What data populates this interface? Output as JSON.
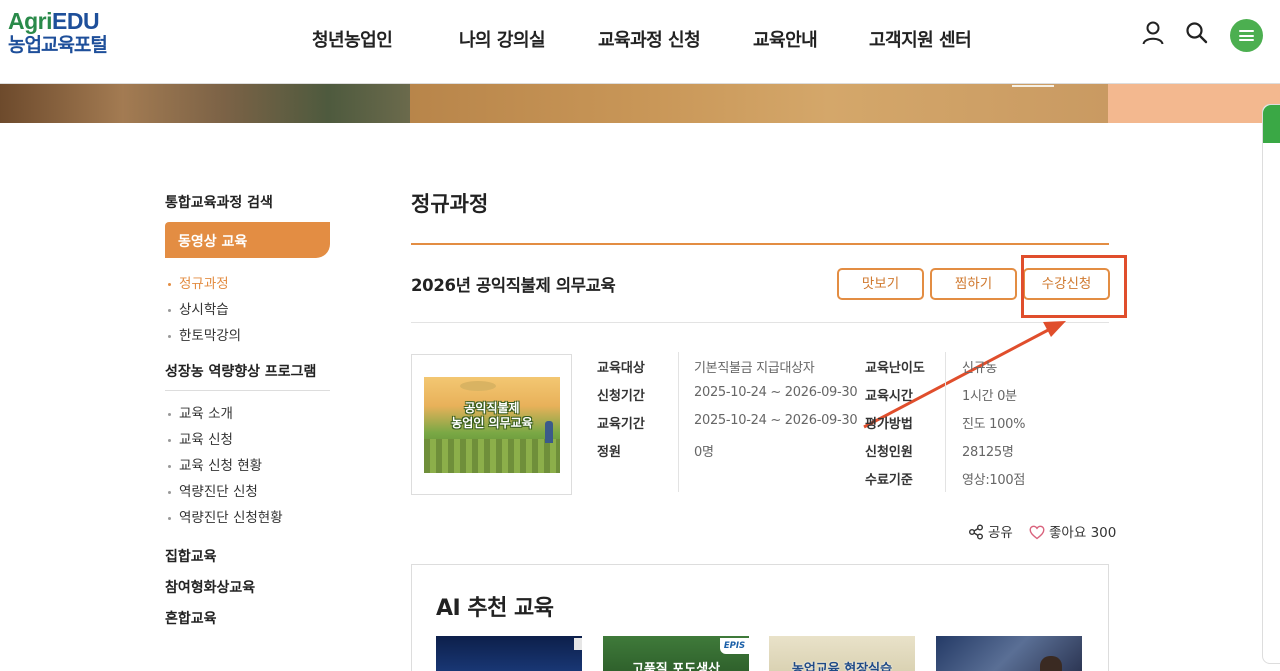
{
  "logo": {
    "line1_agri": "Agri",
    "line1_edu": "EDU",
    "line2": "농업교육포털"
  },
  "gnb": [
    "청년농업인",
    "나의 강의실",
    "교육과정 신청",
    "교육안내",
    "고객지원 센터"
  ],
  "icons": {
    "user": "user-icon",
    "search": "search-icon",
    "menu": "hamburger-menu-icon"
  },
  "colors": {
    "accent": "#e38d43",
    "brand_blue": "#1e4f9a",
    "brand_green": "#4caf50",
    "highlight_red": "#e04e2c"
  },
  "sidebar": {
    "title": "통합교육과정 검색",
    "active": "동영상 교육",
    "video_items": [
      {
        "label": "정규과정",
        "active": true
      },
      {
        "label": "상시학습",
        "active": false
      },
      {
        "label": "한토막강의",
        "active": false
      }
    ],
    "program_title": "성장농 역량향상 프로그램",
    "program_items": [
      "교육 소개",
      "교육 신청",
      "교육 신청 현황",
      "역량진단 신청",
      "역량진단 신청현황"
    ],
    "groups": [
      "집합교육",
      "참여형화상교육",
      "혼합교육"
    ]
  },
  "main": {
    "page_title": "정규과정",
    "course_title": "2026년 공익직불제 의무교육",
    "buttons": {
      "preview": "맛보기",
      "bookmark": "찜하기",
      "apply": "수강신청"
    },
    "thumb_text_1": "공익직불제",
    "thumb_text_2": "농업인 의무교육",
    "info_left": [
      {
        "label": "교육대상",
        "value": "기본직불금 지급대상자"
      },
      {
        "label": "신청기간",
        "value": "2025-10-24 ~ 2026-09-30"
      },
      {
        "label": "교육기간",
        "value": "2025-10-24 ~ 2026-09-30"
      },
      {
        "label": "정원",
        "value": "0명"
      }
    ],
    "info_right": [
      {
        "label": "교육난이도",
        "value": "신규농"
      },
      {
        "label": "교육시간",
        "value": "1시간 0분"
      },
      {
        "label": "평가방법",
        "value": "진도 100%"
      },
      {
        "label": "신청인원",
        "value": "28125명"
      },
      {
        "label": "수료기준",
        "value": "영상:100점"
      }
    ],
    "share_label": "공유",
    "like_label": "좋아요",
    "like_count": "300"
  },
  "ai": {
    "title": "AI 추천 교육",
    "cards": [
      {
        "text": ""
      },
      {
        "text": "고품질 포도생산",
        "badge": "EPIS"
      },
      {
        "text": "농업교육 현장실습"
      },
      {
        "text": ""
      }
    ]
  }
}
